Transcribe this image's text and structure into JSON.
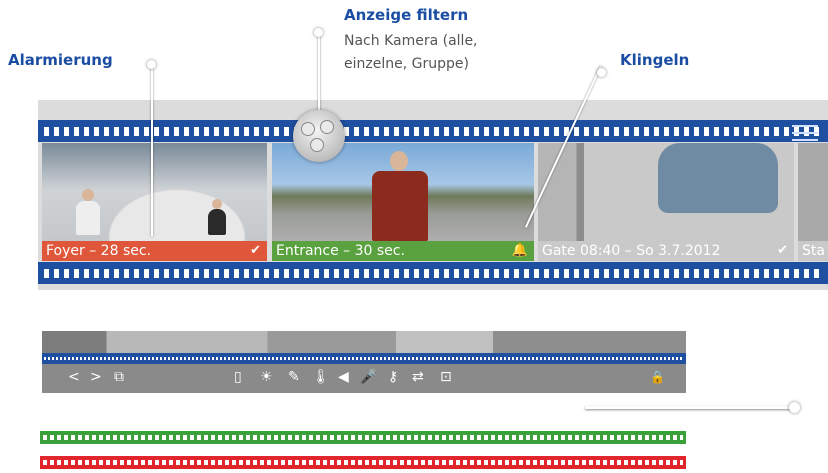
{
  "callouts": {
    "alarm": {
      "title": "Alarmierung"
    },
    "filter": {
      "title": "Anzeige filtern",
      "sub_line1": "Nach Kamera (alle,",
      "sub_line2": "einzelne, Gruppe)"
    },
    "ring": {
      "title": "Klingeln"
    }
  },
  "filmstrip": {
    "frames": [
      {
        "label": "Foyer – 28 sec.",
        "status_color": "#e0563a",
        "icon": "activity-icon"
      },
      {
        "label": "Entrance – 30 sec.",
        "status_color": "#5aa23f",
        "icon": "bell-icon"
      },
      {
        "label": "Gate 08:40 – So 3.7.2012",
        "status_color": "#c9c9c9",
        "icon": "activity-icon"
      },
      {
        "label": "Sta"
      }
    ]
  },
  "toolbar": {
    "icons": [
      {
        "name": "prev-arrow-icon",
        "glyph": "<"
      },
      {
        "name": "next-arrow-icon",
        "glyph": ">"
      },
      {
        "name": "grid-layout-icon",
        "glyph": "⧉"
      },
      {
        "name": "door-icon",
        "glyph": "▯"
      },
      {
        "name": "light-icon",
        "glyph": "☀"
      },
      {
        "name": "tool-icon",
        "glyph": "✎"
      },
      {
        "name": "thermometer-icon",
        "glyph": "🌡"
      },
      {
        "name": "speaker-icon",
        "glyph": "◀"
      },
      {
        "name": "microphone-icon",
        "glyph": "🎤"
      },
      {
        "name": "key-icon",
        "glyph": "⚷"
      },
      {
        "name": "switch-icon",
        "glyph": "⇄"
      },
      {
        "name": "camera-icon",
        "glyph": "⊡"
      },
      {
        "name": "lock-icon",
        "glyph": "🔒"
      }
    ]
  },
  "colors": {
    "brand_blue": "#1f4fa0",
    "green_status": "#3aa13a",
    "red_status": "#e0262a"
  }
}
